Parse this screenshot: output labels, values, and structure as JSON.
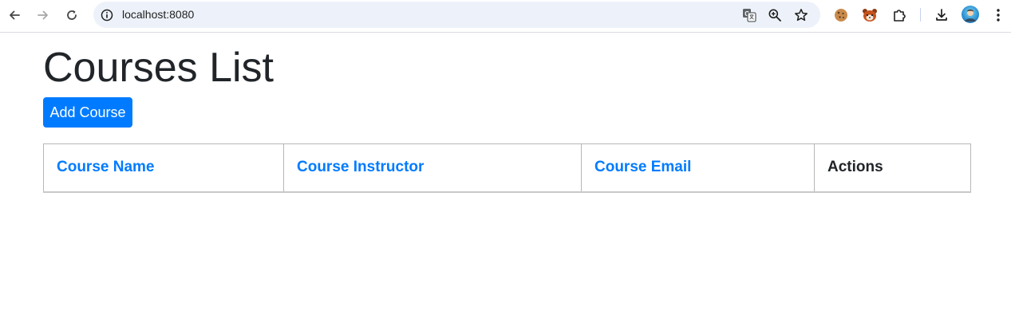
{
  "browser": {
    "url": "localhost:8080",
    "icons": {
      "back": "back-arrow-icon",
      "forward": "forward-arrow-icon",
      "reload": "reload-icon",
      "site_info": "info-icon",
      "translate": "translate-icon",
      "zoom": "zoom-icon",
      "bookmark": "star-icon",
      "extension_1": "cookie-icon",
      "extension_2": "red-panda-icon",
      "extensions": "puzzle-icon",
      "downloads": "download-icon",
      "profile": "avatar",
      "menu": "kebab-menu-icon"
    }
  },
  "page": {
    "title": "Courses List",
    "add_button_label": "Add Course"
  },
  "table": {
    "columns": [
      {
        "label": "Course Name",
        "sortable": true
      },
      {
        "label": "Course Instructor",
        "sortable": true
      },
      {
        "label": "Course Email",
        "sortable": true
      },
      {
        "label": "Actions",
        "sortable": false
      }
    ],
    "rows": []
  },
  "colors": {
    "primary": "#007bff",
    "text": "#212529",
    "omnibox_bg": "#edf2fa",
    "border": "#b7b7b7"
  }
}
